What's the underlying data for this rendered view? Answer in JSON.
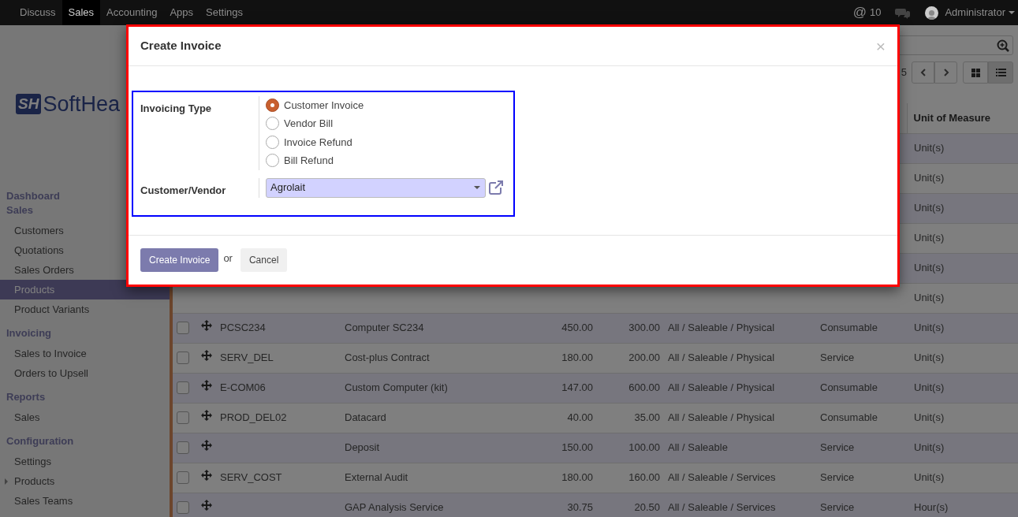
{
  "navbar": {
    "apps": [
      {
        "label": "Discuss",
        "selected": false
      },
      {
        "label": "Sales",
        "selected": true
      },
      {
        "label": "Accounting",
        "selected": false
      },
      {
        "label": "Apps",
        "selected": false
      },
      {
        "label": "Settings",
        "selected": false
      }
    ],
    "mention_symbol": "@",
    "mentions": "10",
    "user": "Administrator"
  },
  "sidebar": {
    "logo_mark": "SH",
    "logo_text": "SoftHea",
    "sections": [
      {
        "title": "Dashboard"
      },
      {
        "title": "Sales",
        "items": [
          {
            "label": "Customers",
            "selected": false,
            "kind": "link"
          },
          {
            "label": "Quotations",
            "selected": false,
            "kind": "link"
          },
          {
            "label": "Sales Orders",
            "selected": false,
            "kind": "link"
          },
          {
            "label": "Products",
            "selected": true,
            "kind": "link"
          },
          {
            "label": "Product Variants",
            "selected": false,
            "kind": "link"
          }
        ]
      },
      {
        "title": "Invoicing",
        "items": [
          {
            "label": "Sales to Invoice",
            "selected": false,
            "kind": "link"
          },
          {
            "label": "Orders to Upsell",
            "selected": false,
            "kind": "link"
          }
        ]
      },
      {
        "title": "Reports",
        "items": [
          {
            "label": "Sales",
            "selected": false,
            "kind": "link"
          }
        ]
      },
      {
        "title": "Configuration",
        "items": [
          {
            "label": "Settings",
            "selected": false,
            "kind": "link"
          },
          {
            "label": "Products",
            "selected": false,
            "kind": "group"
          },
          {
            "label": "Sales Teams",
            "selected": false,
            "kind": "link"
          }
        ]
      }
    ]
  },
  "control_panel": {
    "pager": "5",
    "views": [
      {
        "kind": "kanban",
        "selected": false
      },
      {
        "kind": "list",
        "selected": true
      }
    ]
  },
  "table": {
    "uom_heading": "Unit of Measure",
    "rows": [
      {
        "uom": "Unit(s)"
      },
      {
        "uom": "Unit(s)"
      },
      {
        "uom": "Unit(s)"
      },
      {
        "uom": "Unit(s)"
      },
      {
        "uom": "Unit(s)"
      },
      {
        "uom": "Unit(s)"
      },
      {
        "checked": false,
        "reference": "PCSC234",
        "name": "Computer SC234",
        "sale_price": "450.00",
        "cost": "300.00",
        "category": "All / Saleable / Physical",
        "type": "Consumable",
        "uom": "Unit(s)"
      },
      {
        "checked": false,
        "reference": "SERV_DEL",
        "name": "Cost-plus Contract",
        "sale_price": "180.00",
        "cost": "200.00",
        "category": "All / Saleable / Physical",
        "type": "Service",
        "uom": "Unit(s)"
      },
      {
        "checked": false,
        "reference": "E-COM06",
        "name": "Custom Computer (kit)",
        "sale_price": "147.00",
        "cost": "600.00",
        "category": "All / Saleable / Physical",
        "type": "Consumable",
        "uom": "Unit(s)"
      },
      {
        "checked": false,
        "reference": "PROD_DEL02",
        "name": "Datacard",
        "sale_price": "40.00",
        "cost": "35.00",
        "category": "All / Saleable / Physical",
        "type": "Consumable",
        "uom": "Unit(s)"
      },
      {
        "checked": false,
        "name": "Deposit",
        "sale_price": "150.00",
        "cost": "100.00",
        "category": "All / Saleable",
        "type": "Service",
        "uom": "Unit(s)"
      },
      {
        "checked": false,
        "reference": "SERV_COST",
        "name": "External Audit",
        "sale_price": "180.00",
        "cost": "160.00",
        "category": "All / Saleable / Services",
        "type": "Service",
        "uom": "Unit(s)"
      },
      {
        "checked": false,
        "name": "GAP Analysis Service",
        "sale_price": "30.75",
        "cost": "20.50",
        "category": "All / Saleable / Services",
        "type": "Service",
        "uom": "Hour(s)"
      }
    ]
  },
  "dialog": {
    "title": "Create Invoice",
    "close": "×",
    "fields": [
      {
        "kind": "radio",
        "label": "Invoicing Type",
        "options": [
          {
            "label": "Customer Invoice",
            "selected": true
          },
          {
            "label": "Vendor Bill",
            "selected": false
          },
          {
            "label": "Invoice Refund",
            "selected": false
          },
          {
            "label": "Bill Refund",
            "selected": false
          }
        ]
      },
      {
        "kind": "select",
        "label": "Customer/Vendor",
        "value": "Agrolait"
      }
    ],
    "primary_button": "Create Invoice",
    "separator": "or",
    "cancel_button": "Cancel"
  }
}
